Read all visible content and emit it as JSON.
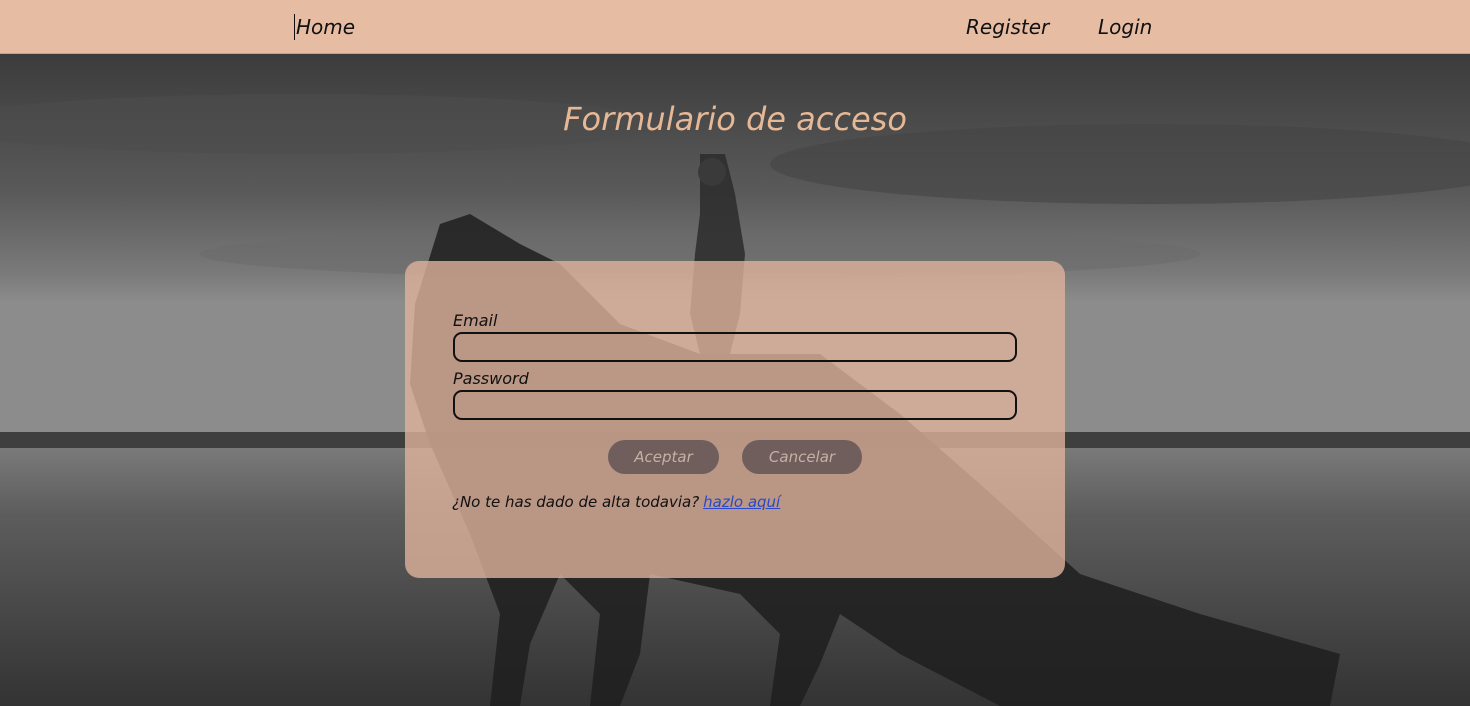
{
  "nav": {
    "home_label": "Home",
    "register_label": "Register",
    "login_label": "Login"
  },
  "page": {
    "title": "Formulario de acceso"
  },
  "form": {
    "email_label": "Email",
    "email_value": "",
    "password_label": "Password",
    "password_value": "",
    "accept_label": "Aceptar",
    "cancel_label": "Cancelar",
    "signup_prompt": "¿No te has dado de alta todavia?",
    "signup_link": "hazlo aquí"
  },
  "colors": {
    "navbar_bg": "#e6bca3",
    "title": "#e6b896",
    "card_bg": "#deb29b",
    "button_bg": "#6f5e5c",
    "button_text": "#c7b0a6",
    "link": "#2a48c8"
  },
  "background": {
    "image_subject": "woman-riding-horse-on-beach-grayscale"
  }
}
